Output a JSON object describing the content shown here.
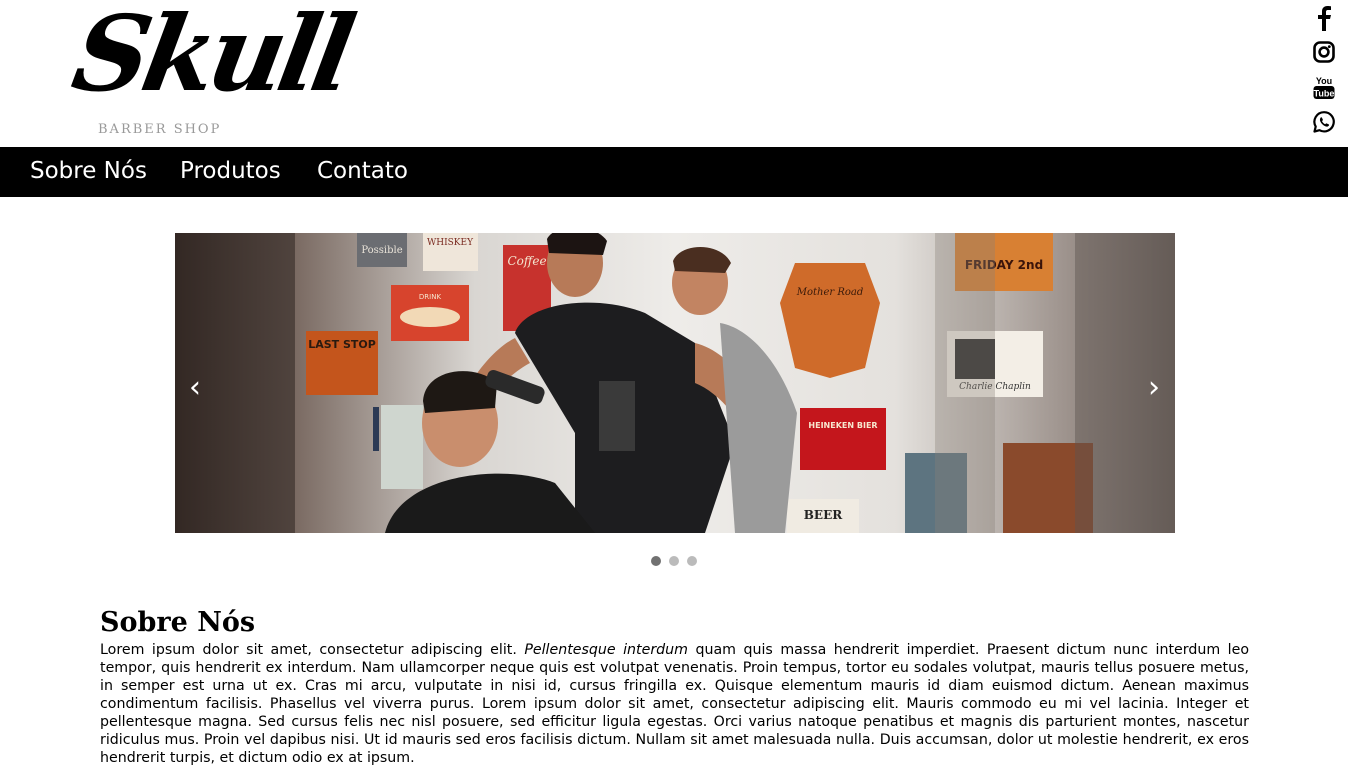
{
  "brand": {
    "name": "Skull",
    "tagline": "BARBER SHOP"
  },
  "social": [
    {
      "icon": "facebook-icon"
    },
    {
      "icon": "instagram-icon"
    },
    {
      "icon": "youtube-icon",
      "text_top": "You",
      "text_bottom": "Tube"
    },
    {
      "icon": "whatsapp-icon"
    }
  ],
  "nav": {
    "items": [
      "Sobre Nós",
      "Produtos",
      "Contato"
    ]
  },
  "carousel": {
    "prev_label": "‹",
    "next_label": "›",
    "slide_count": 3,
    "active_slide": 1,
    "posters": [
      "Possible",
      "WHISKEY",
      "Coffee",
      "DRINK",
      "LAST STOP",
      "Mother Road",
      "FRIDAY 2nd",
      "Charlie Chaplin",
      "HEINEKEN BIER",
      "BEER"
    ]
  },
  "about": {
    "title": "Sobre Nós",
    "text_before": "Lorem ipsum dolor sit amet, consectetur adipiscing elit. ",
    "text_emphasis": "Pellentesque interdum",
    "text_after": " quam quis massa hendrerit imperdiet. Praesent dictum nunc interdum leo tempor, quis hendrerit ex interdum. Nam ullamcorper neque quis est volutpat venenatis. Proin tempus, tortor eu sodales volutpat, mauris tellus posuere metus, in semper est urna ut ex. Cras mi arcu, vulputate in nisi id, cursus fringilla ex. Quisque elementum mauris id diam euismod dictum. Aenean maximus condimentum facilisis. Phasellus vel viverra purus. Lorem ipsum dolor sit amet, consectetur adipiscing elit. Mauris commodo eu mi vel lacinia. Integer et pellentesque magna. Sed cursus felis nec nisl posuere, sed efficitur ligula egestas. Orci varius natoque penatibus et magnis dis parturient montes, nascetur ridiculus mus. Proin vel dapibus nisi. Ut id mauris sed eros facilisis dictum. Nullam sit amet malesuada nulla. Duis accumsan, dolor ut molestie hendrerit, ex eros hendrerit turpis, et dictum odio ex at ipsum."
  },
  "colors": {
    "nav_bg": "#000000",
    "nav_text": "#ffffff",
    "dot_active": "#717171",
    "dot_inactive": "#bbbbbb"
  }
}
